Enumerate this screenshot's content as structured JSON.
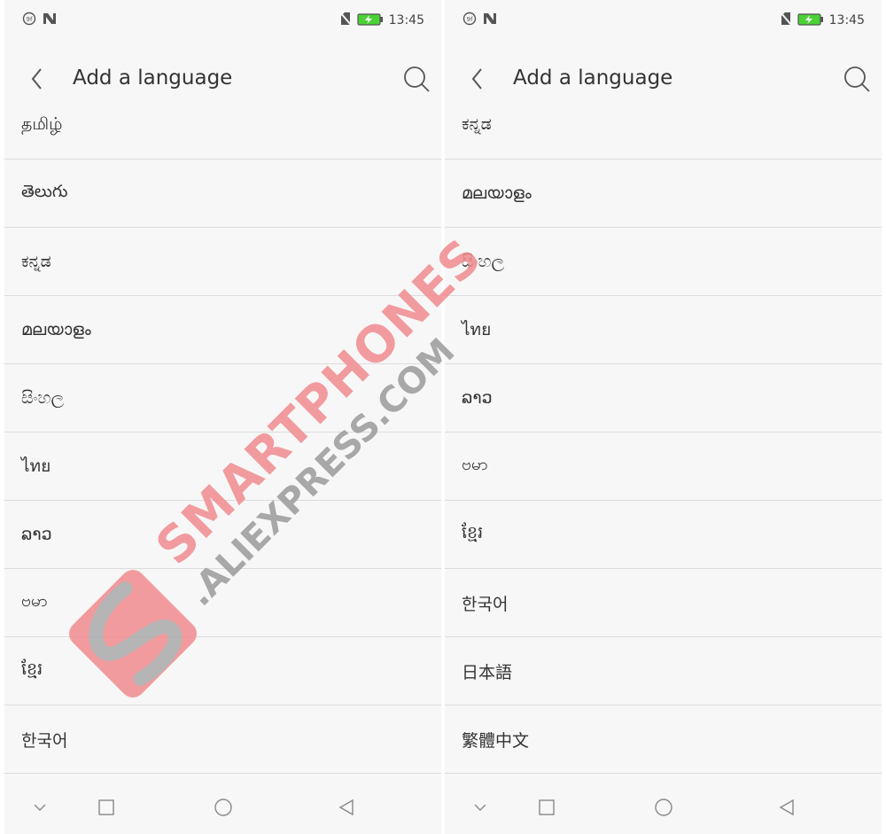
{
  "colors": {
    "accent": "#f08b8f",
    "battery": "#4cd137",
    "divider": "#dcdcdc",
    "background": "#f7f7f7"
  },
  "screens": [
    {
      "status": {
        "time": "13:45",
        "icons": [
          "notification-icon",
          "n-icon",
          "no-sim-icon",
          "battery-charging-icon"
        ]
      },
      "app_bar": {
        "title": "Add a language",
        "back_icon": "chevron-left-icon",
        "search_icon": "search-icon"
      },
      "languages": [
        "தமிழ்",
        "తెలుగు",
        "ಕನ್ನಡ",
        "മലയാളം",
        "සිංහල",
        "ไทย",
        "ລາວ",
        "ဗမာ",
        "ខ្មែរ",
        "한국어"
      ],
      "nav": [
        "chevron-down-icon",
        "square-icon",
        "circle-icon",
        "triangle-left-icon"
      ]
    },
    {
      "status": {
        "time": "13:45",
        "icons": [
          "notification-icon",
          "n-icon",
          "no-sim-icon",
          "battery-charging-icon"
        ]
      },
      "app_bar": {
        "title": "Add a language",
        "back_icon": "chevron-left-icon",
        "search_icon": "search-icon"
      },
      "languages": [
        "ಕನ್ನಡ",
        "മലയാളം",
        "සිංහල",
        "ไทย",
        "ລາວ",
        "ဗမာ",
        "ខ្មែរ",
        "한국어",
        "日本語",
        "繁體中文"
      ],
      "nav": [
        "chevron-down-icon",
        "square-icon",
        "circle-icon",
        "triangle-left-icon"
      ]
    }
  ],
  "watermark": {
    "line1": "SMARTPHONES",
    "line2": ".ALIEXPRESS.COM"
  }
}
